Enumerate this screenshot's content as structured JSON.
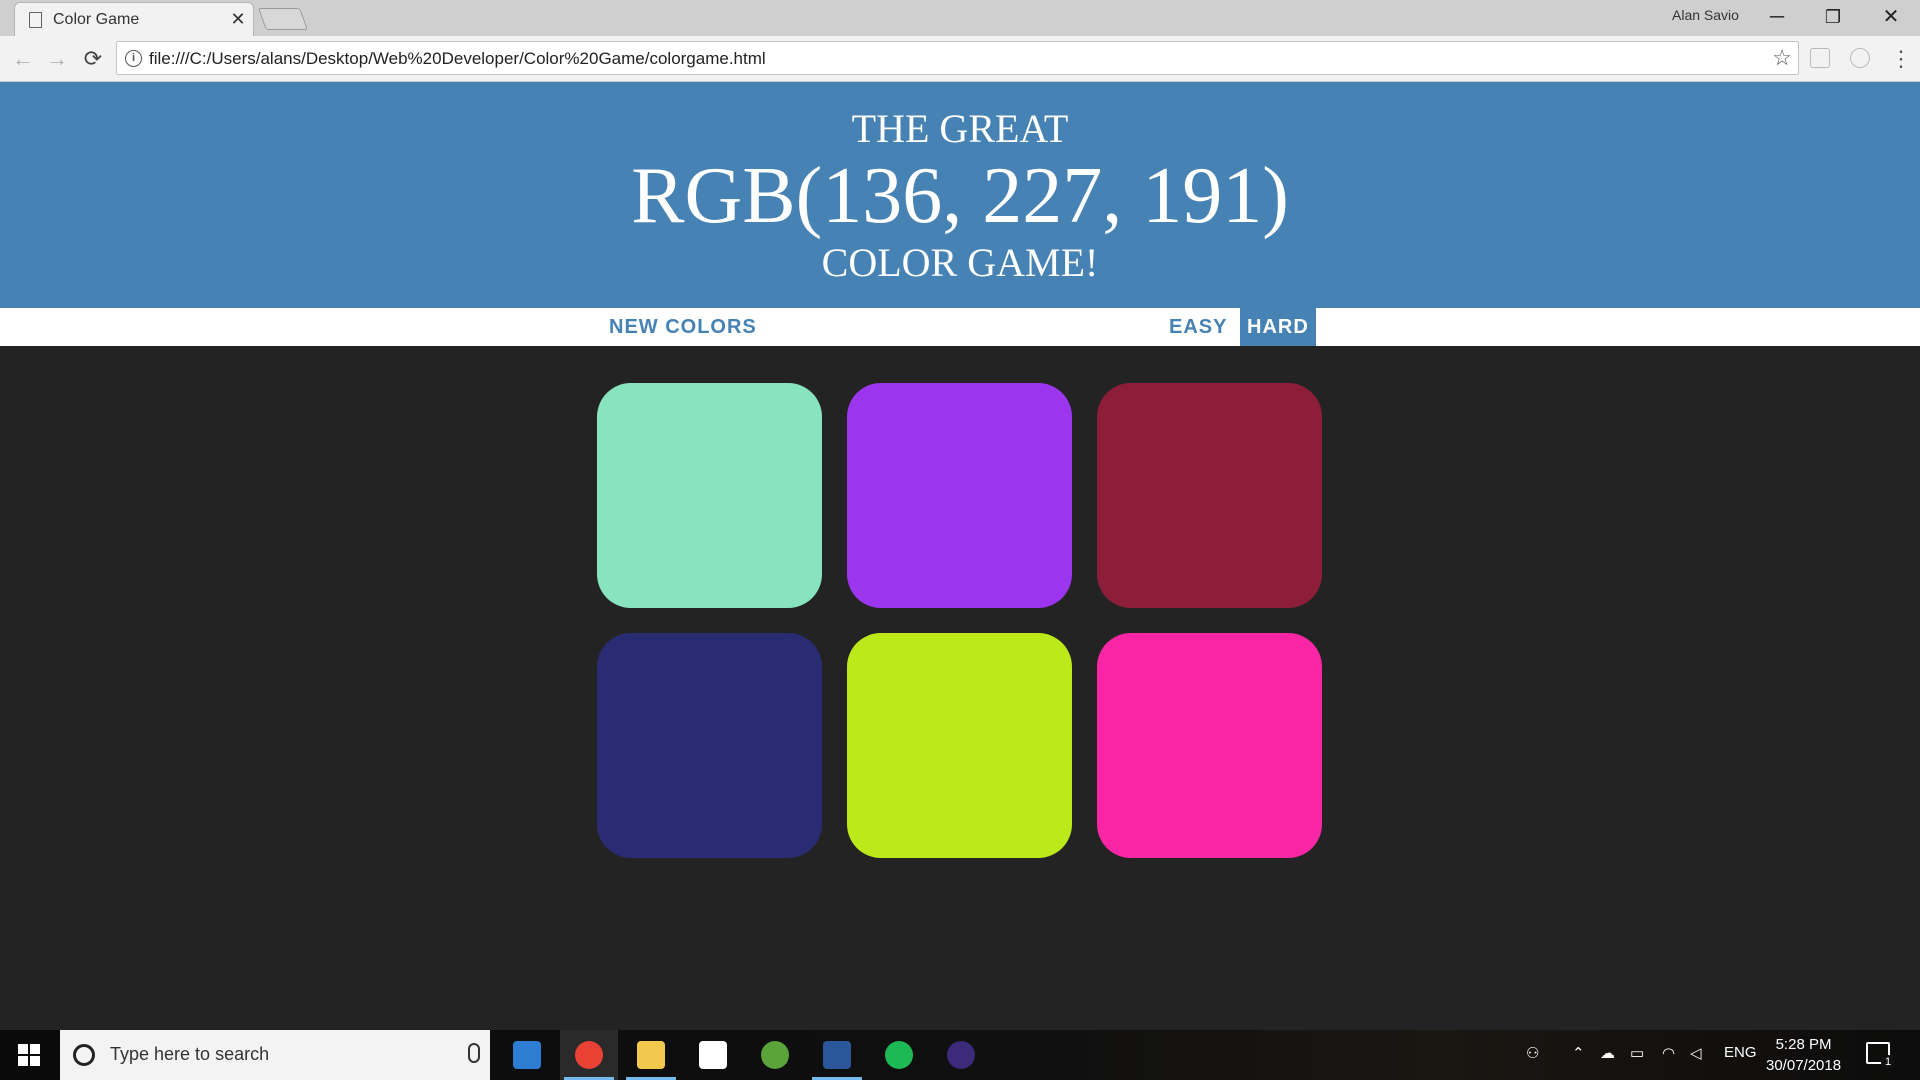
{
  "browser": {
    "tab_title": "Color Game",
    "tab_close": "✕",
    "profile_name": "Alan Savio",
    "url": "file:///C:/Users/alans/Desktop/Web%20Developer/Color%20Game/colorgame.html",
    "window_controls": {
      "minimize": "─",
      "restore": "❐",
      "close": "✕"
    },
    "nav": {
      "back": "←",
      "forward": "→",
      "reload": "⟳",
      "info": "i",
      "star": "☆",
      "menu": "⋮"
    }
  },
  "game": {
    "title_line1": "THE GREAT",
    "target_color": "RGB(136, 227, 191)",
    "title_line3": "COLOR GAME!",
    "header_color": "#4682b4",
    "buttons": {
      "new_colors": "NEW COLORS",
      "easy": "EASY",
      "hard": "HARD",
      "selected_mode": "hard"
    },
    "squares": [
      {
        "color": "rgb(136, 227, 191)"
      },
      {
        "color": "rgb(155, 53, 238)"
      },
      {
        "color": "rgb(140, 30, 58)"
      },
      {
        "color": "rgb(42, 44, 115)"
      },
      {
        "color": "rgb(188, 233, 26)"
      },
      {
        "color": "rgb(250, 38, 165)"
      }
    ]
  },
  "taskbar": {
    "search_placeholder": "Type here to search",
    "apps": [
      {
        "name": "edge",
        "color": "#2d7dd2",
        "active": false
      },
      {
        "name": "chrome",
        "color": "#e94235",
        "active": true
      },
      {
        "name": "file-explorer",
        "color": "#f2c94c",
        "active": false
      },
      {
        "name": "mail",
        "color": "#ffffff",
        "active": false
      },
      {
        "name": "utorrent",
        "color": "#5ba33b",
        "active": false
      },
      {
        "name": "word",
        "color": "#2b579a",
        "active": false
      },
      {
        "name": "spotify",
        "color": "#1db954",
        "active": false
      },
      {
        "name": "eclipse",
        "color": "#3d2a7a",
        "active": false
      }
    ],
    "tray_language": "ENG",
    "time": "5:28 PM",
    "date": "30/07/2018",
    "notification_count": "1"
  }
}
